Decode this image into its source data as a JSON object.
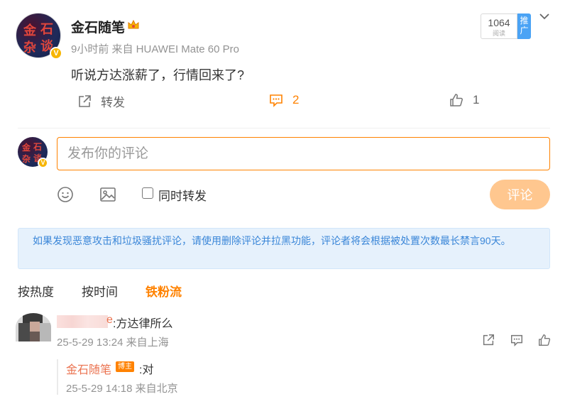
{
  "post": {
    "author": "金石随笔",
    "avatar_text": [
      "金",
      "石",
      "杂",
      "谈"
    ],
    "meta": "9小时前 来自 HUAWEI Mate 60 Pro",
    "content": "听说方达涨薪了，行情回来了?",
    "read_count": "1064",
    "read_label": "阅读",
    "promote_label": "推广",
    "share_label": "转发",
    "comment_count": "2",
    "like_count": "1"
  },
  "composer": {
    "placeholder": "发布你的评论",
    "repost_label": "同时转发",
    "submit_label": "评论"
  },
  "notice": "如果发现恶意攻击和垃圾骚扰评论，请使用删除评论并拉黑功能，评论者将会根据被处置次数最长禁言90天。",
  "sort_tabs": [
    "按热度",
    "按时间",
    "铁粉流"
  ],
  "comment": {
    "user_suffix": "e",
    "text": ":方达律所么",
    "meta": "25-5-29 13:24 来自上海"
  },
  "reply": {
    "user": "金石随笔",
    "badge": "博主",
    "text": ":对",
    "meta": "25-5-29 14:18 来自北京"
  },
  "colors": {
    "accent": "#ff8200",
    "notice_bg": "#e6f1fc",
    "notice_text": "#3a86d8",
    "promote": "#4aa3f5"
  }
}
